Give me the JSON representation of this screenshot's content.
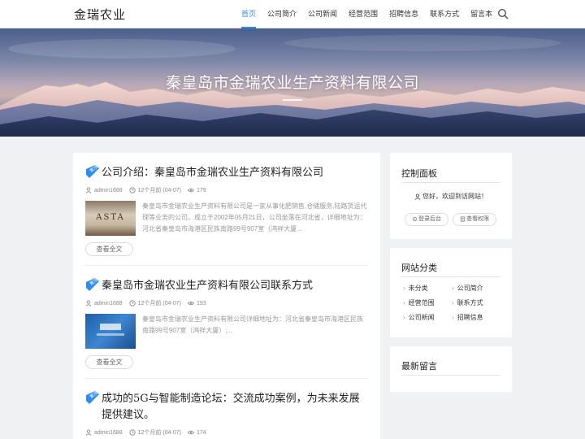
{
  "header": {
    "logo": "金瑞农业",
    "nav": [
      "首页",
      "公司简介",
      "公司新闻",
      "经营范围",
      "招聘信息",
      "联系方式",
      "留言本"
    ],
    "active_nav": "首页",
    "search_icon": "search-icon"
  },
  "banner": {
    "title": "秦皇岛市金瑞农业生产资料有限公司"
  },
  "posts": [
    {
      "badge": "置顶",
      "title": "公司介绍：秦皇岛市金瑞农业生产资料有限公司",
      "author": "admin1688",
      "time": "12个月前 (04-07)",
      "views": "179",
      "thumb_text": "ASTA",
      "excerpt": "秦皇岛市金瑞农业生产资料有限公司是一家从事化肥销售,仓储服务,陆路货运代理等业务的公司，成立于2002年05月21日，公司坐落在河北省，详细地址为：河北省秦皇岛市海港区民族南路99号907室（鸿祥大厦...",
      "readmore": "查看全文"
    },
    {
      "badge": "置顶",
      "title": "秦皇岛市金瑞农业生产资料有限公司联系方式",
      "author": "admin1688",
      "time": "12个月前 (04-07)",
      "views": "193",
      "excerpt": "秦皇岛市金瑞农业生产资料有限公司详细地址为：河北省秦皇岛市海港区民族南路99号907室（鸿祥大厦）;...",
      "readmore": "查看全文"
    },
    {
      "badge": "置顶",
      "title": "成功的5G与智能制造论坛：交流成功案例，为未来发展提供建议。",
      "author": "admin1688",
      "time": "12个月前 (04-07)",
      "views": "174"
    }
  ],
  "sidebar": {
    "control_panel": {
      "title": "控制面板",
      "welcome": "您好，欢迎到访网站！",
      "login": "登录后台",
      "permissions": "查看权限"
    },
    "categories": {
      "title": "网站分类",
      "items": [
        "未分类",
        "公司简介",
        "经营范围",
        "联系方式",
        "公司新闻",
        "招聘信息"
      ]
    },
    "comments": {
      "title": "最新留言"
    }
  },
  "colors": {
    "accent": "#2d8cf0",
    "page_bg": "#f0f1f3"
  }
}
